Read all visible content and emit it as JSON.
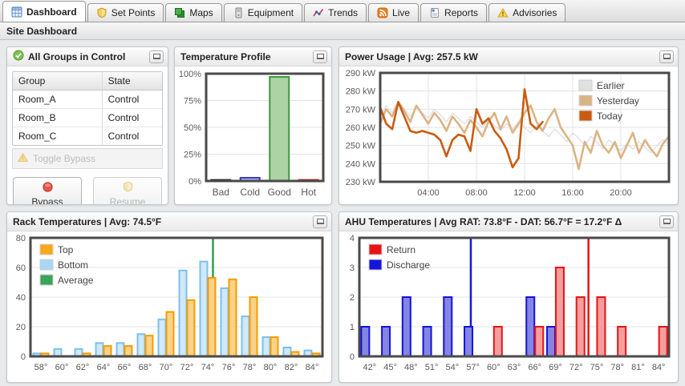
{
  "tabs": [
    {
      "label": "Dashboard",
      "active": true
    },
    {
      "label": "Set Points",
      "active": false
    },
    {
      "label": "Maps",
      "active": false
    },
    {
      "label": "Equipment",
      "active": false
    },
    {
      "label": "Trends",
      "active": false
    },
    {
      "label": "Live",
      "active": false
    },
    {
      "label": "Reports",
      "active": false
    },
    {
      "label": "Advisories",
      "active": false
    }
  ],
  "subheader": "Site Dashboard",
  "icons": {
    "tab_icons": [
      "dashboard-grid-icon",
      "shield-icon",
      "layers-icon",
      "server-icon",
      "trend-line-icon",
      "rss-icon",
      "report-icon",
      "warning-icon"
    ],
    "panel_minimize": "collapse-rectangle",
    "groups_status": "check-circle-icon",
    "bypass": "stop-circle-icon",
    "resume": "shield-icon",
    "toggle_bypass": "warning-triangle-icon"
  },
  "groups_panel": {
    "title": "All Groups in Control",
    "table": {
      "headers": [
        "Group",
        "State"
      ],
      "rows": [
        {
          "group": "Room_A",
          "state": "Control"
        },
        {
          "group": "Room_B",
          "state": "Control"
        },
        {
          "group": "Room_C",
          "state": "Control"
        }
      ]
    },
    "toggle_label": "Toggle Bypass",
    "bypass_label": "Bypass",
    "resume_label": "Resume"
  },
  "chart_data": [
    {
      "id": "temp_profile",
      "title": "Temperature Profile",
      "type": "bar",
      "categories": [
        "Bad",
        "Cold",
        "Good",
        "Hot"
      ],
      "values": [
        1,
        3,
        97,
        1
      ],
      "bar_styles": [
        {
          "stroke": "#1a1a1a",
          "fill": "#4d4d4d"
        },
        {
          "stroke": "#3a3acc",
          "fill": "#b0baee"
        },
        {
          "stroke": "#3d9940",
          "fill": "#abd3a3"
        },
        {
          "stroke": "#cc1111",
          "fill": "#d24040"
        }
      ],
      "ylim": [
        0,
        100
      ],
      "yticks": [
        {
          "v": 0,
          "label": "0%"
        },
        {
          "v": 25,
          "label": "25%"
        },
        {
          "v": 50,
          "label": "50%"
        },
        {
          "v": 75,
          "label": "75%"
        },
        {
          "v": 100,
          "label": "100%"
        }
      ],
      "grid": "horizontal"
    },
    {
      "id": "power",
      "title": "Power Usage | Avg: 257.5 kW",
      "type": "line",
      "xlim": [
        0,
        24
      ],
      "ylim": [
        230,
        290
      ],
      "yticks": [
        {
          "v": 230,
          "label": "230 kW"
        },
        {
          "v": 240,
          "label": "240 kW"
        },
        {
          "v": 250,
          "label": "250 kW"
        },
        {
          "v": 260,
          "label": "260 kW"
        },
        {
          "v": 270,
          "label": "270 kW"
        },
        {
          "v": 280,
          "label": "280 kW"
        },
        {
          "v": 290,
          "label": "290 kW"
        }
      ],
      "xticks": [
        {
          "v": 4,
          "label": "04:00"
        },
        {
          "v": 8,
          "label": "08:00"
        },
        {
          "v": 12,
          "label": "12:00"
        },
        {
          "v": 16,
          "label": "16:00"
        },
        {
          "v": 20,
          "label": "20:00"
        }
      ],
      "legend_position": "top-right",
      "grid": "both",
      "series": [
        {
          "name": "Earlier",
          "color": "#e0e0e0",
          "width": 1.4,
          "step_hours": 0.5,
          "values": [
            266,
            272,
            268,
            274,
            270,
            266,
            271,
            268,
            265,
            270,
            267,
            263,
            268,
            265,
            262,
            266,
            263,
            260,
            264,
            261,
            258,
            262,
            259,
            263,
            260,
            257,
            261,
            258,
            255,
            259,
            256,
            252,
            257,
            254,
            250,
            255,
            252,
            248,
            253,
            250,
            247,
            251,
            248,
            252,
            249,
            246,
            250,
            253,
            251
          ]
        },
        {
          "name": "Yesterday",
          "color": "#dbb485",
          "width": 2.6,
          "step_hours": 0.5,
          "values": [
            262,
            270,
            266,
            274,
            269,
            263,
            272,
            267,
            262,
            268,
            264,
            258,
            266,
            262,
            257,
            264,
            260,
            255,
            263,
            268,
            259,
            266,
            257,
            262,
            268,
            272,
            263,
            258,
            265,
            270,
            260,
            255,
            250,
            237,
            252,
            246,
            258,
            250,
            246,
            252,
            243,
            250,
            257,
            246,
            253,
            248,
            244,
            251,
            255
          ]
        },
        {
          "name": "Today",
          "color": "#c95c11",
          "width": 2.6,
          "step_hours": 0.5,
          "values": [
            271,
            262,
            259,
            274,
            266,
            258,
            257,
            258,
            257,
            256,
            253,
            244,
            253,
            256,
            255,
            247,
            270,
            262,
            265,
            258,
            254,
            248,
            238,
            243,
            281,
            262,
            259,
            263
          ]
        }
      ]
    },
    {
      "id": "rack",
      "title": "Rack Temperatures | Avg: 74.5°F",
      "type": "grouped-bar",
      "categories": [
        "58°",
        "60°",
        "62°",
        "64°",
        "66°",
        "68°",
        "70°",
        "72°",
        "74°",
        "76°",
        "78°",
        "80°",
        "82°",
        "84°"
      ],
      "cat_start": 58,
      "cat_step": 2,
      "ylim": [
        0,
        80
      ],
      "yticks": [
        {
          "v": 0,
          "label": "0"
        },
        {
          "v": 20,
          "label": "20"
        },
        {
          "v": 40,
          "label": "40"
        },
        {
          "v": 60,
          "label": "60"
        },
        {
          "v": 80,
          "label": "80"
        }
      ],
      "legend_position": "top-left",
      "grid": "horizontal",
      "series": [
        {
          "name": "Top",
          "stroke": "#f59c00",
          "fill": "#fbd289",
          "legend_color": "#fba81c",
          "values": [
            2,
            0,
            2,
            7,
            7,
            14,
            30,
            38,
            53,
            52,
            40,
            13,
            3,
            2
          ]
        },
        {
          "name": "Bottom",
          "stroke": "#7cc0ea",
          "fill": "#cfe9fb",
          "legend_color": "#a9d7f5",
          "values": [
            2,
            5,
            5,
            9,
            9,
            15,
            25,
            58,
            64,
            46,
            27,
            13,
            6,
            4
          ]
        }
      ],
      "avg_line": {
        "name": "Average",
        "value": 74.5,
        "color": "#2f9e4f",
        "legend_color": "#3aa45b"
      }
    },
    {
      "id": "ahu",
      "title": "AHU Temperatures | Avg RAT: 73.8°F - DAT: 56.7°F = 17.2°F Δ",
      "type": "grouped-bar",
      "categories": [
        "42°",
        "45°",
        "48°",
        "51°",
        "54°",
        "57°",
        "60°",
        "63°",
        "66°",
        "69°",
        "72°",
        "75°",
        "78°",
        "81°",
        "84°"
      ],
      "cat_start": 42,
      "cat_step": 3,
      "ylim": [
        0,
        4
      ],
      "yticks": [
        {
          "v": 0,
          "label": "0"
        },
        {
          "v": 1,
          "label": "1"
        },
        {
          "v": 2,
          "label": "2"
        },
        {
          "v": 3,
          "label": "3"
        },
        {
          "v": 4,
          "label": "4"
        }
      ],
      "legend_position": "top-left",
      "grid": "horizontal",
      "series": [
        {
          "name": "Return",
          "stroke": "#e81414",
          "fill": "#f59e9e",
          "legend_color": "#e81414",
          "values": [
            0,
            0,
            0,
            0,
            0,
            0,
            1,
            0,
            1,
            3,
            2,
            2,
            1,
            0,
            1
          ]
        },
        {
          "name": "Discharge",
          "stroke": "#1414dc",
          "fill": "#8585e2",
          "legend_color": "#1414dc",
          "values": [
            1,
            1,
            2,
            1,
            2,
            1,
            0,
            0,
            2,
            1,
            0,
            0,
            0,
            0,
            0
          ]
        }
      ],
      "vlines": [
        {
          "name": "DAT avg",
          "value": 56.7,
          "color": "#1414dc"
        },
        {
          "name": "RAT avg",
          "value": 73.8,
          "color": "#e81414"
        }
      ]
    }
  ],
  "colors": {
    "frame": "#4a4a4a",
    "gridline": "#e3e3e3",
    "tick_text": "#5a5a5a",
    "panel_border": "#c6c6c6"
  }
}
